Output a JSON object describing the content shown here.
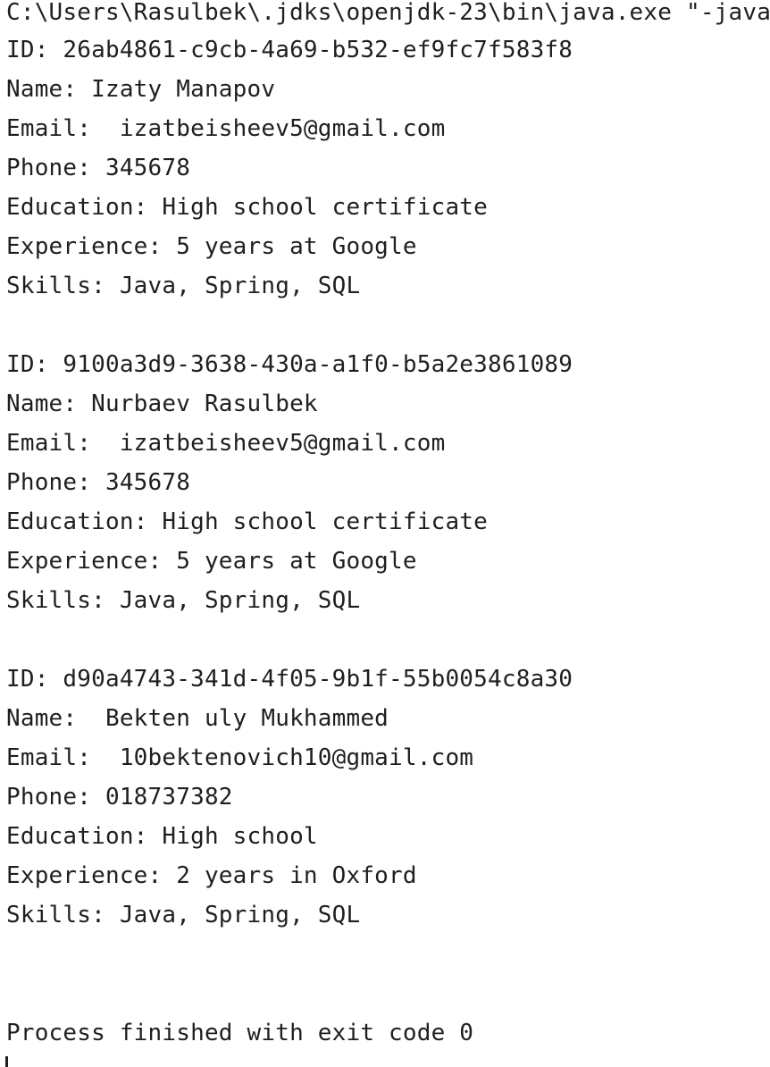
{
  "console": {
    "command": "C:\\Users\\Rasulbek\\.jdks\\openjdk-23\\bin\\java.exe \"-java",
    "records": [
      {
        "id": "ID: 26ab4861-c9cb-4a69-b532-ef9fc7f583f8",
        "name": "Name: Izaty Manapov",
        "email": "Email:  izatbeisheev5@gmail.com",
        "phone": "Phone: 345678",
        "education": "Education: High school certificate",
        "experience": "Experience: 5 years at Google",
        "skills": "Skills: Java, Spring, SQL"
      },
      {
        "id": "ID: 9100a3d9-3638-430a-a1f0-b5a2e3861089",
        "name": "Name: Nurbaev Rasulbek",
        "email": "Email:  izatbeisheev5@gmail.com",
        "phone": "Phone: 345678",
        "education": "Education: High school certificate",
        "experience": "Experience: 5 years at Google",
        "skills": "Skills: Java, Spring, SQL"
      },
      {
        "id": "ID: d90a4743-341d-4f05-9b1f-55b0054c8a30",
        "name": "Name:  Bekten uly Mukhammed",
        "email": "Email:  10bektenovich10@gmail.com",
        "phone": "Phone: 018737382",
        "education": "Education: High school",
        "experience": "Experience: 2 years in Oxford",
        "skills": "Skills: Java, Spring, SQL"
      }
    ],
    "exit_message": "Process finished with exit code 0"
  }
}
